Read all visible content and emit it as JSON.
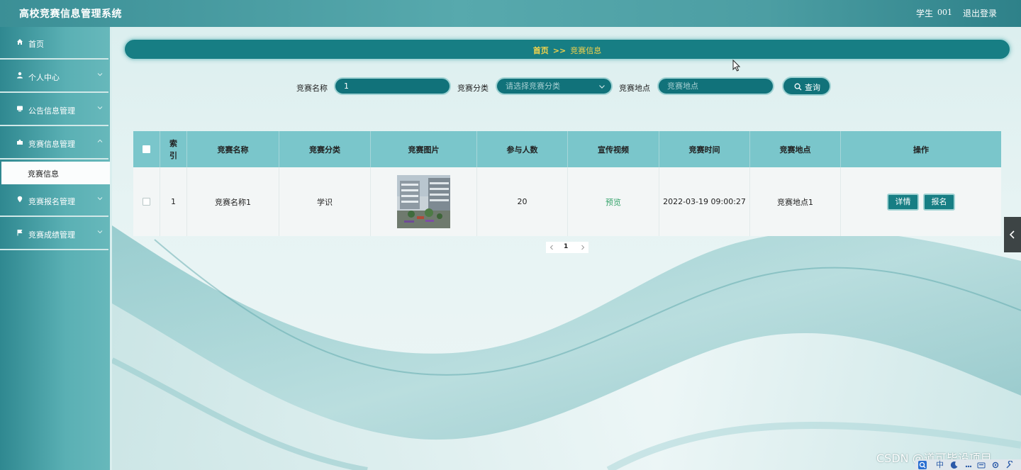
{
  "header": {
    "app_title": "高校竞赛信息管理系统",
    "user_role": "学生",
    "user_id": "001",
    "logout_label": "退出登录"
  },
  "sidebar": {
    "items": [
      {
        "label": "首页",
        "icon": "home-icon"
      },
      {
        "label": "个人中心",
        "icon": "user-icon"
      },
      {
        "label": "公告信息管理",
        "icon": "notice-icon"
      },
      {
        "label": "竞赛信息管理",
        "icon": "competition-icon"
      },
      {
        "label": "竞赛报名管理",
        "icon": "location-pin-icon"
      },
      {
        "label": "竞赛成绩管理",
        "icon": "flag-icon"
      }
    ],
    "active_sub_item": "竞赛信息"
  },
  "breadcrumb": {
    "home": "首页",
    "separator": ">>",
    "current": "竞赛信息"
  },
  "filters": {
    "name_label": "竞赛名称",
    "name_value": "1",
    "category_label": "竞赛分类",
    "category_placeholder": "请选择竞赛分类",
    "location_label": "竞赛地点",
    "location_placeholder": "竞赛地点",
    "search_label": "查询"
  },
  "table": {
    "columns": [
      "索引",
      "竞赛名称",
      "竞赛分类",
      "竞赛图片",
      "参与人数",
      "宣传视频",
      "竞赛时间",
      "竞赛地点",
      "操作"
    ],
    "rows": [
      {
        "index": "1",
        "name": "竞赛名称1",
        "category": "学识",
        "participants": "20",
        "video_link": "预览",
        "time": "2022-03-19 09:00:27",
        "location": "竞赛地点1",
        "detail_label": "详情",
        "signup_label": "报名"
      }
    ]
  },
  "pagination": {
    "current_page": "1"
  },
  "watermark": "CSDN @道可毕设项目",
  "taskbar": {
    "input_mode": "中"
  },
  "colors": {
    "header": "#4c9ea3",
    "accent_dark": "#177e84",
    "table_header": "#7ac6cb",
    "breadcrumb_text": "#f4d34b",
    "link_green": "#36a36b"
  }
}
